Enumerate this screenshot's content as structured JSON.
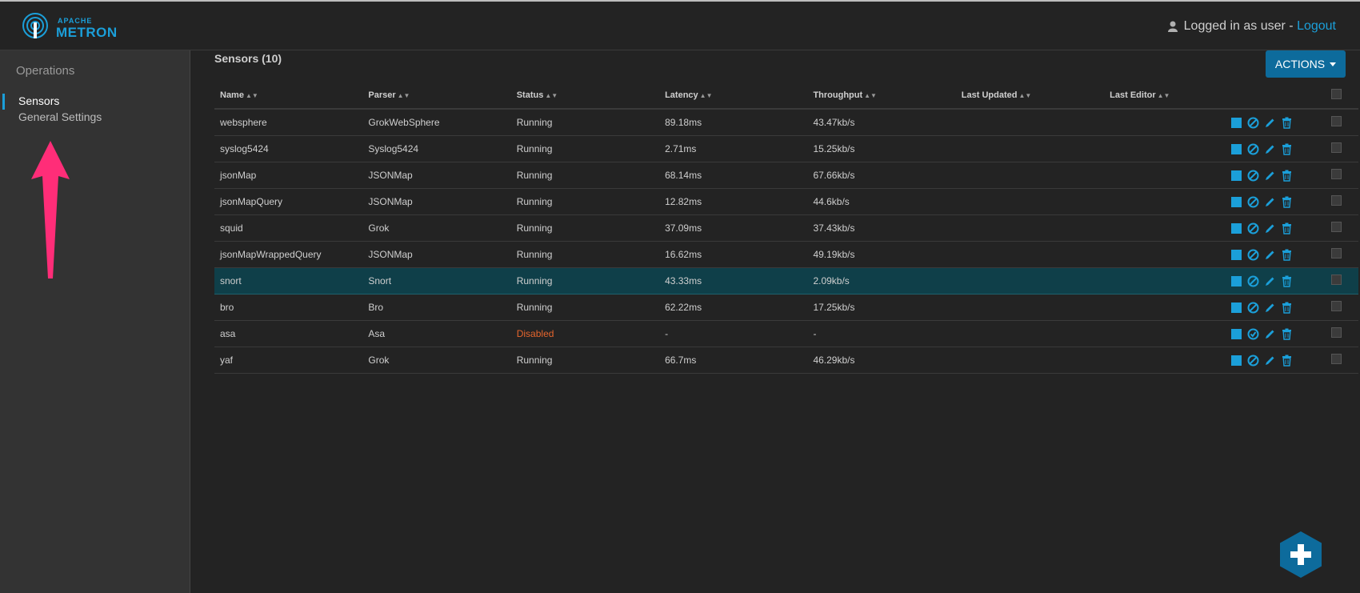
{
  "header": {
    "logo_top": "APACHE",
    "logo_bottom": "METRON",
    "user_text": "Logged in as user - ",
    "logout_label": "Logout"
  },
  "sidebar": {
    "section_label": "Operations",
    "items": [
      {
        "label": "Sensors",
        "active": true
      },
      {
        "label": "General Settings",
        "active": false
      }
    ]
  },
  "main": {
    "title": "Sensors (10)",
    "actions_label": "ACTIONS",
    "columns": [
      "Name",
      "Parser",
      "Status",
      "Latency",
      "Throughput",
      "Last Updated",
      "Last Editor"
    ],
    "rows": [
      {
        "name": "websphere",
        "parser": "GrokWebSphere",
        "status": "Running",
        "latency": "89.18ms",
        "throughput": "43.47kb/s"
      },
      {
        "name": "syslog5424",
        "parser": "Syslog5424",
        "status": "Running",
        "latency": "2.71ms",
        "throughput": "15.25kb/s"
      },
      {
        "name": "jsonMap",
        "parser": "JSONMap",
        "status": "Running",
        "latency": "68.14ms",
        "throughput": "67.66kb/s"
      },
      {
        "name": "jsonMapQuery",
        "parser": "JSONMap",
        "status": "Running",
        "latency": "12.82ms",
        "throughput": "44.6kb/s"
      },
      {
        "name": "squid",
        "parser": "Grok",
        "status": "Running",
        "latency": "37.09ms",
        "throughput": "37.43kb/s"
      },
      {
        "name": "jsonMapWrappedQuery",
        "parser": "JSONMap",
        "status": "Running",
        "latency": "16.62ms",
        "throughput": "49.19kb/s"
      },
      {
        "name": "snort",
        "parser": "Snort",
        "status": "Running",
        "latency": "43.33ms",
        "throughput": "2.09kb/s"
      },
      {
        "name": "bro",
        "parser": "Bro",
        "status": "Running",
        "latency": "62.22ms",
        "throughput": "17.25kb/s"
      },
      {
        "name": "asa",
        "parser": "Asa",
        "status": "Disabled",
        "latency": "-",
        "throughput": "-"
      },
      {
        "name": "yaf",
        "parser": "Grok",
        "status": "Running",
        "latency": "66.7ms",
        "throughput": "46.29kb/s"
      }
    ],
    "selected_row": "snort"
  },
  "icons": {
    "stop": "stop-icon",
    "disable": "ban-icon",
    "enable": "check-circle-icon",
    "edit": "pencil-icon",
    "delete": "trash-icon",
    "add": "plus-icon"
  },
  "colors": {
    "accent": "#1b9fd9",
    "button": "#0d6b9c",
    "disabled": "#e5652d",
    "selected_row": "#0f3f49",
    "annotation_arrow": "#ff2d78"
  }
}
